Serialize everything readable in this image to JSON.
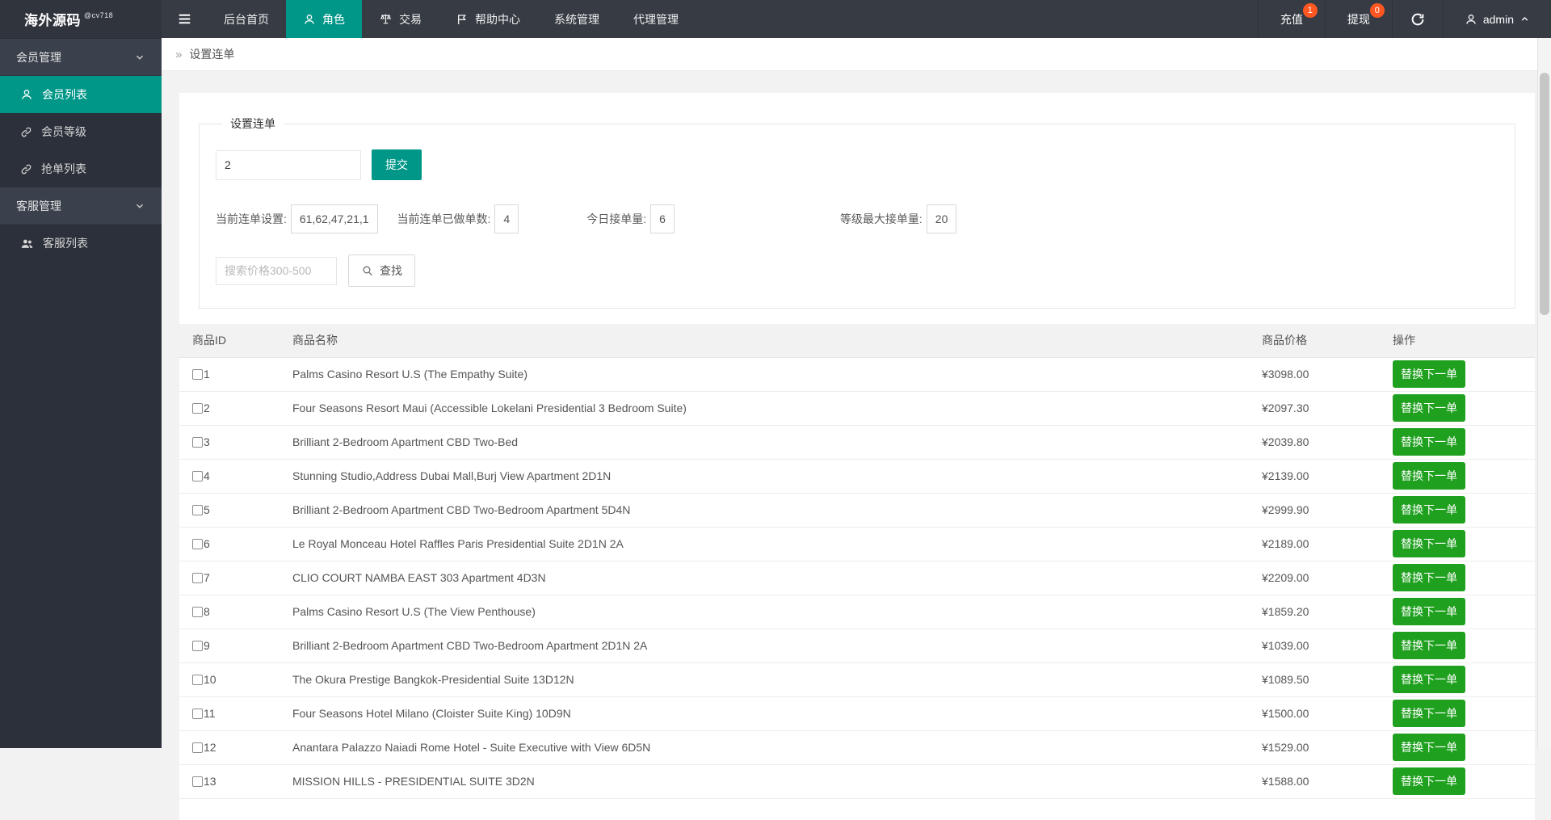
{
  "brand": {
    "name": "海外源码",
    "sub": "@cv718"
  },
  "topnav": {
    "items": [
      {
        "key": "dashboard",
        "label": "后台首页",
        "icon": null,
        "active": false
      },
      {
        "key": "role",
        "label": "角色",
        "icon": "user-icon",
        "active": true
      },
      {
        "key": "trade",
        "label": "交易",
        "icon": "scales-icon",
        "active": false
      },
      {
        "key": "help-center",
        "label": "帮助中心",
        "icon": "flag-icon",
        "active": false
      },
      {
        "key": "system",
        "label": "系统管理",
        "icon": null,
        "active": false
      },
      {
        "key": "agent",
        "label": "代理管理",
        "icon": null,
        "active": false
      }
    ],
    "actions": [
      {
        "key": "recharge",
        "label": "充值",
        "badge": "1"
      },
      {
        "key": "withdraw",
        "label": "提现",
        "badge": "0"
      }
    ],
    "user": {
      "name": "admin"
    }
  },
  "sidebar": {
    "groups": [
      {
        "key": "member",
        "label": "会员管理",
        "items": [
          {
            "key": "member-list",
            "label": "会员列表",
            "icon": "user-icon",
            "active": true
          },
          {
            "key": "member-level",
            "label": "会员等级",
            "icon": "link-icon",
            "active": false
          },
          {
            "key": "grab-list",
            "label": "抢单列表",
            "icon": "link-icon",
            "active": false
          }
        ]
      },
      {
        "key": "service",
        "label": "客服管理",
        "items": [
          {
            "key": "service-list",
            "label": "客服列表",
            "icon": "users-icon",
            "active": false
          }
        ]
      }
    ]
  },
  "breadcrumb": {
    "label": "设置连单"
  },
  "form": {
    "legend": "设置连单",
    "chain_input": {
      "value": "2"
    },
    "submit_label": "提交",
    "stats": [
      {
        "label": "当前连单设置:",
        "value": "61,62,47,21,1"
      },
      {
        "label": "当前连单已做单数:",
        "value": "4"
      },
      {
        "label": "今日接单量:",
        "value": "6"
      },
      {
        "label": "等级最大接单量:",
        "value": "20"
      }
    ],
    "search": {
      "placeholder": "搜索价格300-500",
      "button_label": "查找"
    }
  },
  "table": {
    "headers": [
      "商品ID",
      "商品名称",
      "商品价格",
      "操作"
    ],
    "action_label": "替换下一单",
    "rows": [
      {
        "id": "1",
        "name": "Palms Casino Resort U.S (The Empathy Suite)",
        "price": "¥3098.00"
      },
      {
        "id": "2",
        "name": "Four Seasons Resort Maui (Accessible Lokelani Presidential 3 Bedroom Suite)",
        "price": "¥2097.30"
      },
      {
        "id": "3",
        "name": "Brilliant 2-Bedroom Apartment CBD Two-Bed",
        "price": "¥2039.80"
      },
      {
        "id": "4",
        "name": "Stunning Studio,Address Dubai Mall,Burj View Apartment 2D1N",
        "price": "¥2139.00"
      },
      {
        "id": "5",
        "name": "Brilliant 2-Bedroom Apartment CBD Two-Bedroom Apartment 5D4N",
        "price": "¥2999.90"
      },
      {
        "id": "6",
        "name": "Le Royal Monceau Hotel Raffles Paris Presidential Suite 2D1N 2A",
        "price": "¥2189.00"
      },
      {
        "id": "7",
        "name": "CLIO COURT NAMBA EAST 303 Apartment 4D3N",
        "price": "¥2209.00"
      },
      {
        "id": "8",
        "name": "Palms Casino Resort U.S (The View Penthouse)",
        "price": "¥1859.20"
      },
      {
        "id": "9",
        "name": "Brilliant 2-Bedroom Apartment CBD Two-Bedroom Apartment 2D1N 2A",
        "price": "¥1039.00"
      },
      {
        "id": "10",
        "name": "The Okura Prestige Bangkok-Presidential Suite 13D12N",
        "price": "¥1089.50"
      },
      {
        "id": "11",
        "name": "Four Seasons Hotel Milano (Cloister Suite King) 10D9N",
        "price": "¥1500.00"
      },
      {
        "id": "12",
        "name": "Anantara Palazzo Naiadi Rome Hotel - Suite Executive with View 6D5N",
        "price": "¥1529.00"
      },
      {
        "id": "13",
        "name": "MISSION HILLS - PRESIDENTIAL SUITE 3D2N",
        "price": "¥1588.00"
      }
    ]
  },
  "colors": {
    "accent": "#009688",
    "badge": "#FF5722",
    "action_green": "#1FA01F",
    "header_bg": "#363B44",
    "sidebar_bg": "#2B303A",
    "group_bg": "#3A404C"
  }
}
